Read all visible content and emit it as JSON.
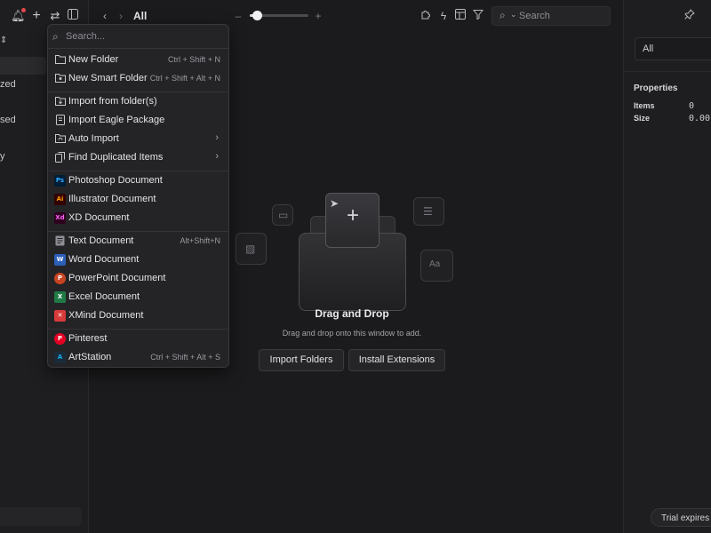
{
  "colors": {
    "background": "#1b1b1d",
    "menu_bg": "#242427",
    "accent_notification": "#e5484d"
  },
  "sidebar": {
    "fragments": [
      "zed",
      "sed",
      "y"
    ],
    "icons": [
      "notification-bell-icon",
      "add-icon",
      "sync-icon",
      "sidebar-toggle-icon",
      "sort-icon"
    ]
  },
  "toolbar": {
    "breadcrumb": "All",
    "zoom_level": 0.12,
    "icons": [
      "back-icon",
      "forward-icon",
      "zoom-out-icon",
      "zoom-in-icon",
      "plugin-icon",
      "quick-action-icon",
      "layout-icon",
      "filter-icon",
      "search-icon"
    ]
  },
  "search": {
    "placeholder": "Search"
  },
  "menu": {
    "search_placeholder": "Search...",
    "groups": [
      [
        {
          "icon": "new-folder-icon",
          "label": "New Folder",
          "shortcut": "Ctrl + Shift + N"
        },
        {
          "icon": "smart-folder-icon",
          "label": "New Smart Folder",
          "shortcut": "Ctrl + Shift + Alt + N"
        }
      ],
      [
        {
          "icon": "import-folder-icon",
          "label": "Import from folder(s)",
          "shortcut": ""
        },
        {
          "icon": "package-icon",
          "label": "Import Eagle Package",
          "shortcut": ""
        },
        {
          "icon": "auto-import-icon",
          "label": "Auto Import",
          "submenu": true
        },
        {
          "icon": "duplicate-icon",
          "label": "Find Duplicated Items",
          "submenu": true
        }
      ],
      [
        {
          "icon": "photoshop-icon",
          "badge": "Ps",
          "badge_color": "#31a8ff",
          "badge_bg": "#001e36",
          "label": "Photoshop Document"
        },
        {
          "icon": "illustrator-icon",
          "badge": "Ai",
          "badge_color": "#ff9a00",
          "badge_bg": "#330000",
          "label": "Illustrator Document"
        },
        {
          "icon": "xd-icon",
          "badge": "Xd",
          "badge_color": "#ff61f6",
          "badge_bg": "#2e001e",
          "label": "XD Document"
        }
      ],
      [
        {
          "icon": "text-document-icon",
          "label": "Text Document",
          "shortcut": "Alt+Shift+N"
        },
        {
          "icon": "word-icon",
          "badge": "W",
          "badge_color": "#ffffff",
          "badge_bg": "#2b5fb8",
          "label": "Word Document"
        },
        {
          "icon": "powerpoint-icon",
          "badge": "P",
          "badge_color": "#ffffff",
          "badge_bg": "#c84321",
          "label": "PowerPoint Document"
        },
        {
          "icon": "excel-icon",
          "badge": "X",
          "badge_color": "#ffffff",
          "badge_bg": "#1f7a45",
          "label": "Excel Document"
        },
        {
          "icon": "xmind-icon",
          "badge": "✕",
          "badge_color": "#ffffff",
          "badge_bg": "#d83a3a",
          "label": "XMind Document"
        }
      ],
      [
        {
          "icon": "pinterest-icon",
          "badge": "P",
          "badge_color": "#ffffff",
          "badge_bg": "#e60023",
          "label": "Pinterest"
        },
        {
          "icon": "artstation-icon",
          "badge": "A",
          "badge_color": "#13aff0",
          "badge_bg": "#1b2b3a",
          "label": "ArtStation",
          "shortcut": "Ctrl + Shift + Alt + S"
        }
      ]
    ]
  },
  "empty_state": {
    "title": "Drag and Drop",
    "subtitle": "Drag and drop onto this window to add.",
    "import_button": "Import Folders",
    "extensions_button": "Install Extensions"
  },
  "right_panel": {
    "filter": "All",
    "properties_title": "Properties",
    "items_label": "Items",
    "items_value": "0",
    "size_label": "Size",
    "size_value": "0.00",
    "trial_text": "Trial expires in"
  }
}
